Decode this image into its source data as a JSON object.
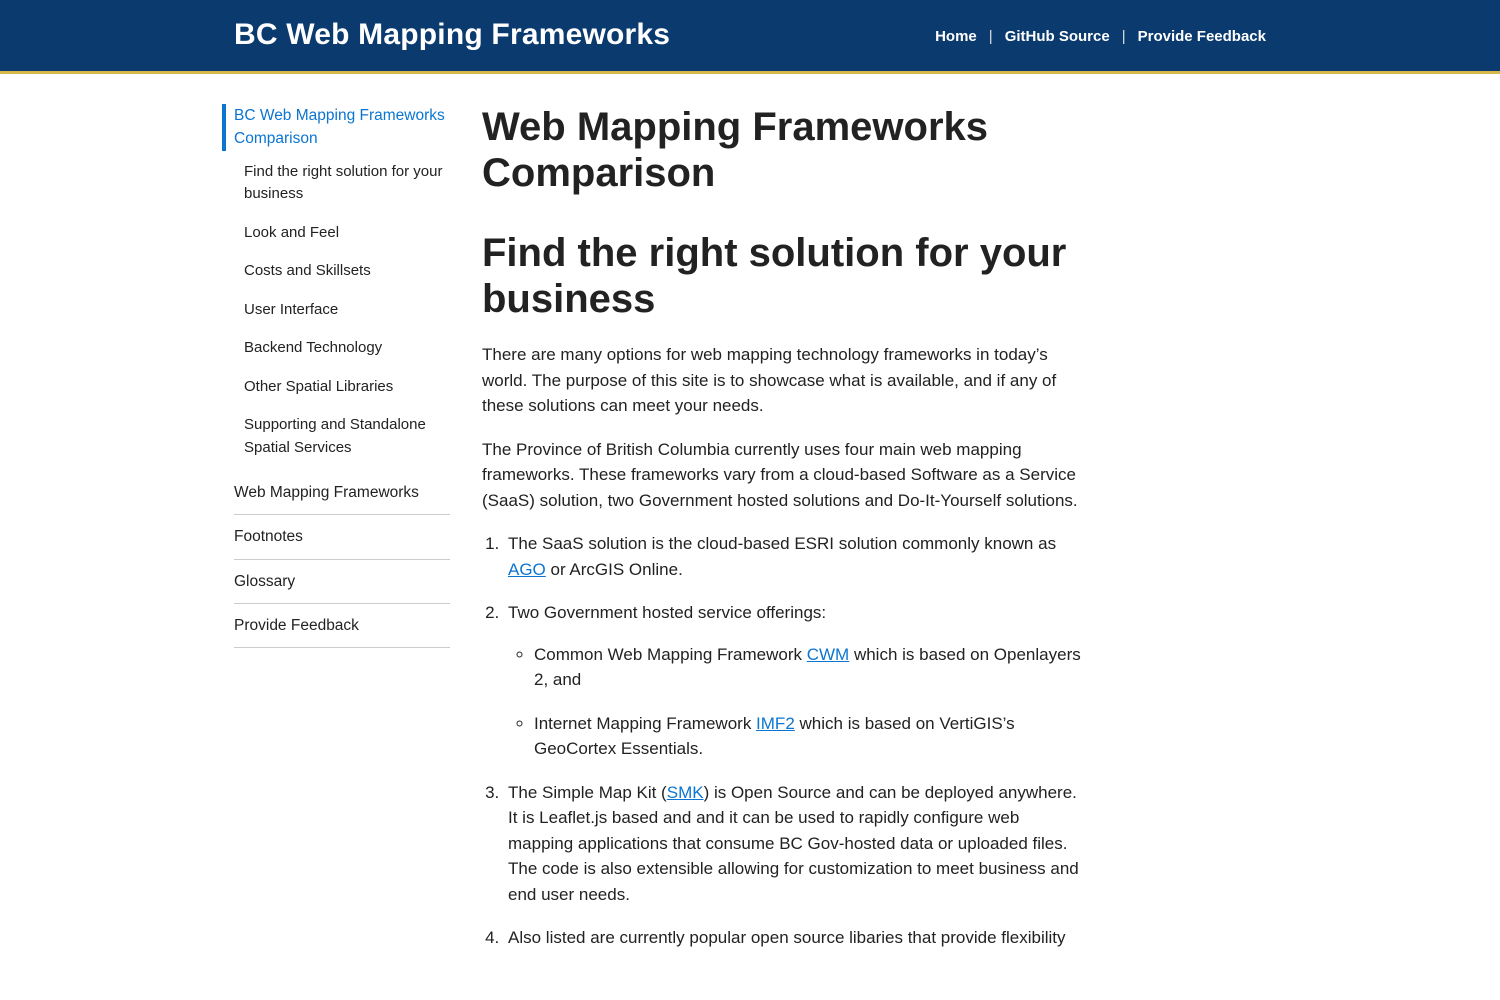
{
  "header": {
    "brand": "BC Web Mapping Frameworks",
    "nav": {
      "home": "Home",
      "github": "GitHub Source",
      "feedback": "Provide Feedback"
    }
  },
  "sidebar": {
    "active": "BC Web Mapping Frameworks Comparison",
    "sub": {
      "s1": "Find the right solution for your business",
      "s2": "Look and Feel",
      "s3": "Costs and Skillsets",
      "s4": "User Interface",
      "s5": "Backend Technology",
      "s6": "Other Spatial Libraries",
      "s7": "Supporting and Standalone Spatial Services"
    },
    "items": {
      "i2": "Web Mapping Frameworks",
      "i3": "Footnotes",
      "i4": "Glossary",
      "i5": "Provide Feedback"
    }
  },
  "content": {
    "h1": "Web Mapping Frameworks Comparison",
    "h2": "Find the right solution for your business",
    "p1": "There are many options for web mapping technology frameworks in today’s world. The purpose of this site is to showcase what is available, and if any of these solutions can meet your needs.",
    "p2": "The Province of British Columbia currently uses four main web mapping frameworks. These frameworks vary from a cloud-based Software as a Service (SaaS) solution, two Government hosted solutions and Do-It-Yourself solutions.",
    "li1a": "The SaaS solution is the cloud-based ESRI solution commonly known as ",
    "li1link": "AGO",
    "li1b": " or ArcGIS Online.",
    "li2": "Two Government hosted service offerings:",
    "li2s1a": "Common Web Mapping Framework ",
    "li2s1link": "CWM",
    "li2s1b": " which is based on Openlayers 2, and",
    "li2s2a": "Internet Mapping Framework ",
    "li2s2link": "IMF2",
    "li2s2b": " which is based on VertiGIS’s GeoCortex Essentials.",
    "li3a": "The Simple Map Kit (",
    "li3link": "SMK",
    "li3b": ") is Open Source and can be deployed anywhere. It is Leaflet.js based and and it can be used to rapidly configure web mapping applications that consume BC Gov-hosted data or uploaded files. The code is also extensible allowing for customization to meet business and end user needs.",
    "li4": "Also listed are currently popular open source libaries that provide flexibility"
  }
}
